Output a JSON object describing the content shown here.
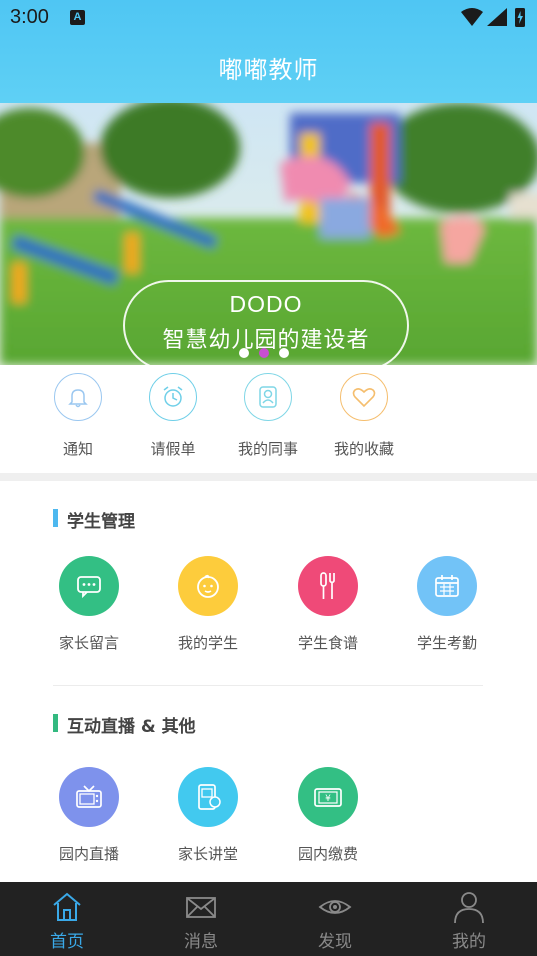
{
  "status_bar": {
    "time": "3:00",
    "notification_badge": "A"
  },
  "header": {
    "title": "嘟嘟教师"
  },
  "banner": {
    "line1": "DODO",
    "line2": "智慧幼儿园的建设者",
    "pages": 3,
    "active_page": 2
  },
  "quick_links": [
    {
      "label": "通知",
      "icon": "bell-icon",
      "color": "#9ac7f0"
    },
    {
      "label": "请假单",
      "icon": "alarm-clock-icon",
      "color": "#6fcfe8"
    },
    {
      "label": "我的同事",
      "icon": "colleague-icon",
      "color": "#7fd6e6"
    },
    {
      "label": "我的收藏",
      "icon": "heart-icon",
      "color": "#f5be6e"
    }
  ],
  "student_section": {
    "title": "学生管理",
    "accent": "#4db8ef",
    "items": [
      {
        "label": "家长留言",
        "icon": "message-icon",
        "color": "#33bf84"
      },
      {
        "label": "我的学生",
        "icon": "baby-face-icon",
        "color": "#fdcc3c"
      },
      {
        "label": "学生食谱",
        "icon": "utensils-icon",
        "color": "#ef4a78"
      },
      {
        "label": "学生考勤",
        "icon": "calendar-icon",
        "color": "#72c3f7"
      }
    ]
  },
  "live_section": {
    "title": "互动直播 & 其他",
    "accent": "#33b980",
    "items": [
      {
        "label": "园内直播",
        "icon": "tv-icon",
        "color": "#7e92ec"
      },
      {
        "label": "家长讲堂",
        "icon": "lecture-icon",
        "color": "#42c9ef"
      },
      {
        "label": "园内缴费",
        "icon": "payment-icon",
        "color": "#33bf84"
      }
    ]
  },
  "tab_bar": {
    "active_color": "#3aa9e8",
    "tabs": [
      {
        "label": "首页",
        "icon": "home-icon",
        "active": true
      },
      {
        "label": "消息",
        "icon": "mail-icon",
        "active": false
      },
      {
        "label": "发现",
        "icon": "eye-icon",
        "active": false
      },
      {
        "label": "我的",
        "icon": "person-icon",
        "active": false
      }
    ]
  }
}
